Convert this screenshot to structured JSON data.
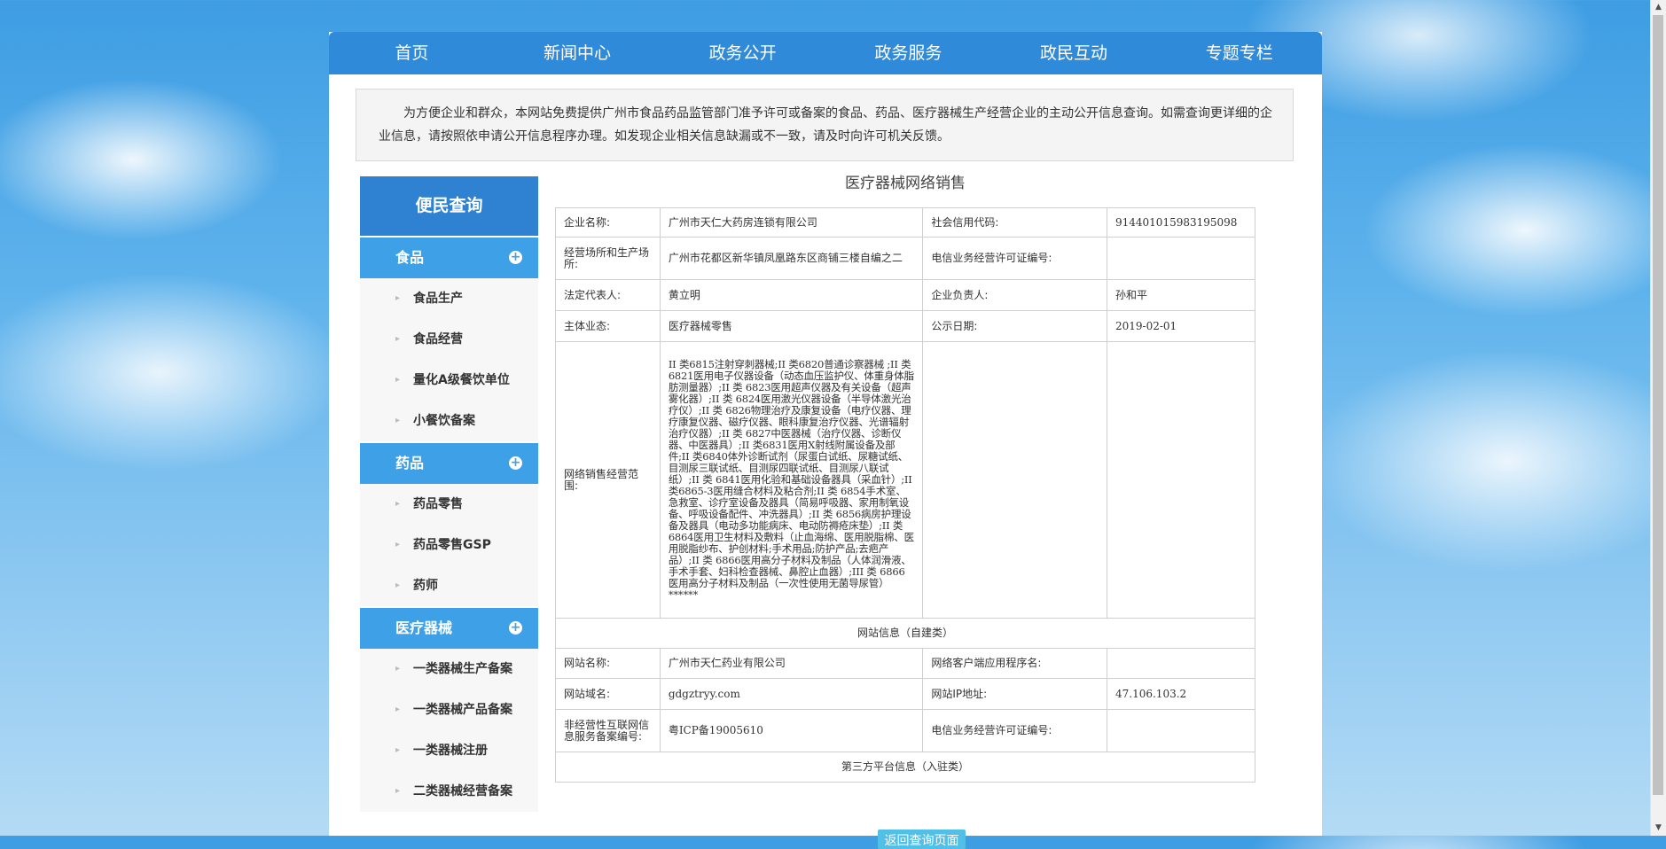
{
  "nav": [
    "首页",
    "新闻中心",
    "政务公开",
    "政务服务",
    "政民互动",
    "专题专栏"
  ],
  "notice": "为方便企业和群众，本网站免费提供广州市食品药品监管部门准予许可或备案的食品、药品、医疗器械生产经营企业的主动公开信息查询。如需查询更详细的企业信息，请按照依申请公开信息程序办理。如发现企业相关信息缺漏或不一致，请及时向许可机关反馈。",
  "sidebar": {
    "title": "便民查询",
    "categories": [
      {
        "label": "食品",
        "items": [
          "食品生产",
          "食品经营",
          "量化A级餐饮单位",
          "小餐饮备案"
        ]
      },
      {
        "label": "药品",
        "items": [
          "药品零售",
          "药品零售GSP",
          "药师"
        ]
      },
      {
        "label": "医疗器械",
        "items": [
          "一类器械生产备案",
          "一类器械产品备案",
          "一类器械注册",
          "二类器械经营备案"
        ]
      }
    ]
  },
  "content": {
    "title": "医疗器械网络销售",
    "rows": {
      "company_name_label": "企业名称:",
      "company_name": "广州市天仁大药房连锁有限公司",
      "credit_code_label": "社会信用代码:",
      "credit_code": "914401015983195098",
      "address_label": "经营场所和生产场所:",
      "address": "广州市花都区新华镇凤凰路东区商铺三楼自编之二",
      "telecom_label": "电信业务经营许可证编号:",
      "telecom": "",
      "legal_rep_label": "法定代表人:",
      "legal_rep": "黄立明",
      "principal_label": "企业负责人:",
      "principal": "孙和平",
      "business_label": "主体业态:",
      "business": "医疗器械零售",
      "publish_date_label": "公示日期:",
      "publish_date": "2019-02-01",
      "scope_label": "网络销售经营范围:",
      "scope": "II 类6815注射穿刺器械;II 类6820普通诊察器械 ;II 类6821医用电子仪器设备（动态血压监护仪、体重身体脂肪测量器）;II 类 6823医用超声仪器及有关设备（超声雾化器）;II 类 6824医用激光仪器设备（半导体激光治疗仪）;II 类 6826物理治疗及康复设备（电疗仪器、理疗康复仪器、磁疗仪器、眼科康复治疗仪器、光谱辐射治疗仪器）;II 类 6827中医器械（治疗仪器、诊断仪器、中医器具）;II 类6831医用X射线附属设备及部件;II 类6840体外诊断试剂（尿蛋白试纸、尿糖试纸、目测尿三联试纸、目测尿四联试纸、目测尿八联试纸）;II 类 6841医用化验和基础设备器具（采血针）;II 类6865-3医用缝合材料及粘合剂;II 类 6854手术室、急救室、诊疗室设备及器具（简易呼吸器、家用制氧设备、呼吸设备配件、冲洗器具）;II 类 6856病房护理设备及器具（电动多功能病床、电动防褥疮床垫）;II 类 6864医用卫生材料及敷料（止血海绵、医用脱脂棉、医用脱脂纱布、护创材料;手术用品;防护产品;去疤产品）;II 类 6866医用高分子材料及制品（人体润滑液、手术手套、妇科检查器械、鼻腔止血器）;III 类 6866医用高分子材料及制品（一次性使用无菌导尿管）******",
      "website_section": "网站信息（自建类）",
      "site_name_label": "网站名称:",
      "site_name": "广州市天仁药业有限公司",
      "client_app_label": "网络客户端应用程序名:",
      "client_app": "",
      "domain_label": "网站域名:",
      "domain": "gdgztryy.com",
      "ip_label": "网站IP地址:",
      "ip": "47.106.103.2",
      "icp_label": "非经营性互联网信息服务备案编号:",
      "icp": "粤ICP备19005610",
      "telecom2_label": "电信业务经营许可证编号:",
      "telecom2": "",
      "third_party_section": "第三方平台信息（入驻类）"
    },
    "back_button": "返回查询页面"
  }
}
